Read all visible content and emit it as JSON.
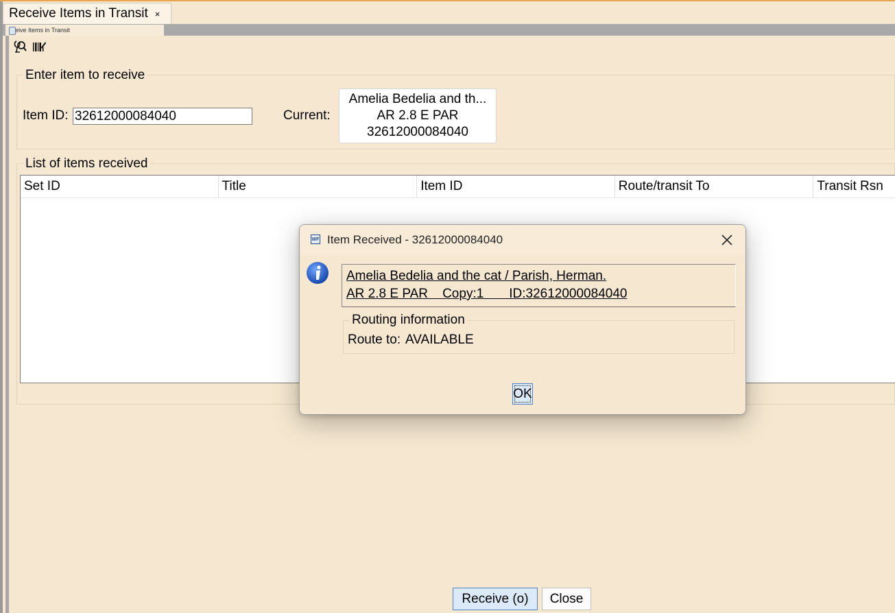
{
  "window": {
    "tab_title": "Receive Items in Transit",
    "tab_close_glyph": "×",
    "subtab_title": "eive Items in Transit"
  },
  "toolbar": {
    "icons": [
      "search-item-icon",
      "barcode-icon"
    ]
  },
  "enter_item": {
    "legend": "Enter item to receive",
    "item_id_label": "Item ID:",
    "item_id_value": "32612000084040",
    "current_label": "Current:",
    "current_lines": [
      "Amelia Bedelia and th...",
      "AR 2.8 E PAR",
      "32612000084040"
    ]
  },
  "received_list": {
    "legend": "List of items received",
    "columns": [
      "Set ID",
      "Title",
      "Item ID",
      "Route/transit To",
      "Transit Rsn"
    ],
    "rows": []
  },
  "dialog": {
    "title": "Item Received - 32612000084040",
    "title_icon_text": "WF",
    "item_title_line": "Amelia Bedelia and the cat / Parish, Herman.",
    "item_detail_line": "AR 2.8 E PAR    Copy:1       ID:32612000084040",
    "routing_legend": "Routing information",
    "route_label": "Route to:",
    "route_value": "AVAILABLE",
    "ok_label": "OK"
  },
  "buttons": {
    "receive_label": "Receive (o)",
    "close_label": "Close"
  },
  "colors": {
    "background": "#f5e7d0",
    "accent_border": "#4f7fc9",
    "info_blue": "#1f57c3"
  }
}
